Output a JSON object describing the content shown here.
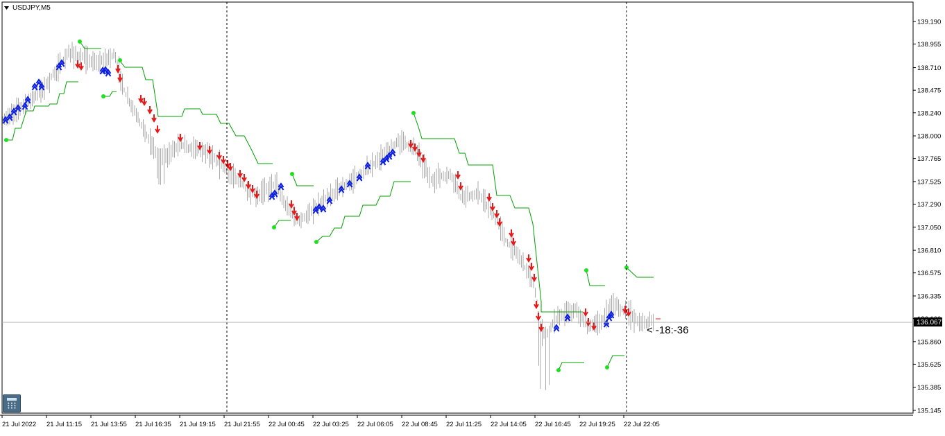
{
  "window": {
    "symbol_label": "USDJPY,M5",
    "countdown_label": "< -18:-36",
    "current_price_label": "136.067"
  },
  "icons": {
    "collapse": "triangle-down-icon",
    "calculator": "calculator-icon",
    "buy_signal": "blue-up-double-arrow-icon",
    "sell_signal": "red-down-double-arrow-icon"
  },
  "colors": {
    "bars": "#a9a9a9",
    "trail_line": "#00a000",
    "trail_dot": "#1ee01e",
    "buy_arrow": "#0b1ee0",
    "sell_arrow": "#e81818",
    "grid_sep": "#000000",
    "price_line": "#b0b0b0",
    "price_tag_bg": "#000000",
    "price_tag_text": "#ffffff"
  },
  "chart_data": {
    "type": "ohlc-bar",
    "symbol": "USDJPY",
    "timeframe": "M5",
    "y_ticks": [
      "139.190",
      "138.955",
      "138.710",
      "138.475",
      "138.240",
      "138.000",
      "137.765",
      "137.525",
      "137.290",
      "137.050",
      "136.810",
      "136.575",
      "136.335",
      "136.100",
      "135.860",
      "135.625",
      "135.385",
      "135.145"
    ],
    "ylim": [
      135.145,
      139.19
    ],
    "x_ticks": [
      "21 Jul 2022",
      "21 Jul 11:15",
      "21 Jul 13:55",
      "21 Jul 16:35",
      "21 Jul 19:15",
      "21 Jul 21:55",
      "22 Jul 00:45",
      "22 Jul 03:25",
      "22 Jul 06:05",
      "22 Jul 08:45",
      "22 Jul 11:25",
      "22 Jul 14:05",
      "22 Jul 16:45",
      "22 Jul 19:25",
      "22 Jul 22:05"
    ],
    "day_separators": [
      "21 Jul 21:55",
      "22 Jul 22:05"
    ],
    "current_price": 136.067,
    "close_path": [
      [
        "21 Jul 2022",
        138.17
      ],
      [
        "21 Jul 11:15",
        138.85
      ],
      [
        "21 Jul 13:55",
        138.72
      ],
      [
        "21 Jul 16:35",
        137.95
      ],
      [
        "21 Jul 19:15",
        137.82
      ],
      [
        "21 Jul 21:55",
        137.38
      ],
      [
        "22 Jul 00:45",
        137.15
      ],
      [
        "22 Jul 03:25",
        137.4
      ],
      [
        "22 Jul 06:05",
        137.62
      ],
      [
        "22 Jul 08:45",
        137.82
      ],
      [
        "22 Jul 11:25",
        137.45
      ],
      [
        "22 Jul 14:05",
        136.75
      ],
      [
        "22 Jul 16:45",
        136.05
      ],
      [
        "22 Jul 19:25",
        136.1
      ],
      [
        "22 Jul 22:05",
        136.07
      ]
    ],
    "trailing_stop": [
      {
        "side": "support",
        "points": [
          [
            137.95,
            137.95
          ],
          [
            138.45,
            138.45
          ]
        ]
      },
      {
        "side": "resistance",
        "points": [
          [
            138.91,
            138.91
          ],
          [
            138.78,
            137.75
          ]
        ]
      },
      {
        "side": "resistance",
        "points": [
          [
            137.59,
            137.48
          ]
        ]
      },
      {
        "side": "support",
        "points": [
          [
            137.06,
            137.6
          ]
        ]
      },
      {
        "side": "resistance",
        "points": [
          [
            138.24,
            136.07
          ]
        ]
      },
      {
        "side": "resistance",
        "points": [
          [
            136.56,
            136.6
          ]
        ]
      },
      {
        "side": "support",
        "points": [
          [
            135.58,
            135.73
          ]
        ]
      }
    ]
  }
}
